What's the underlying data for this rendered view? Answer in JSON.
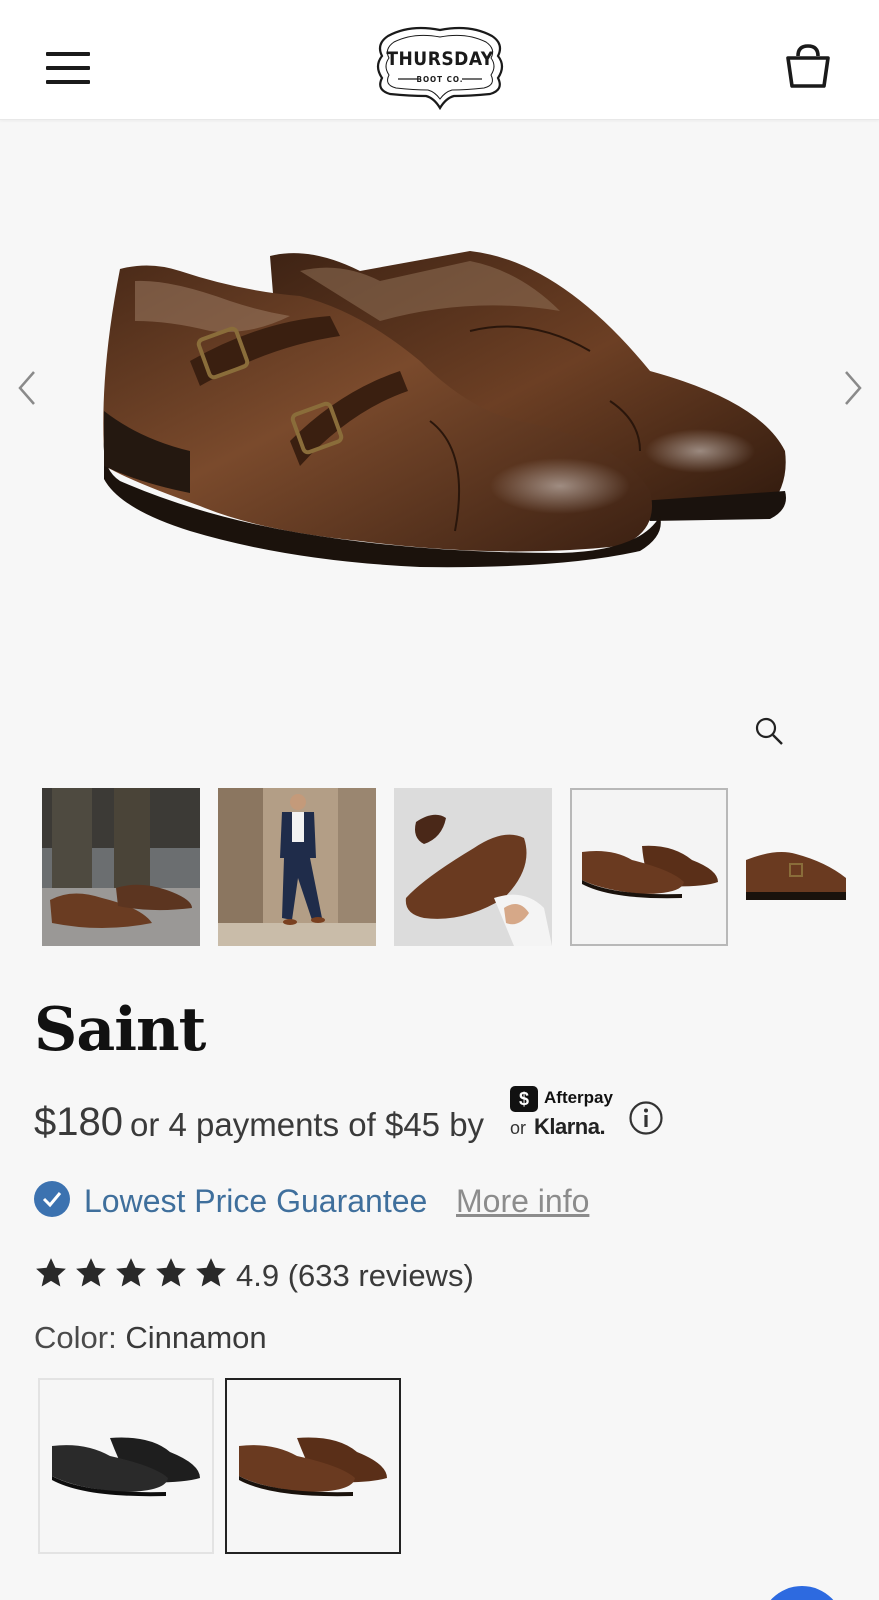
{
  "header": {
    "logo_main": "THURSDAY",
    "logo_sub": "BOOT CO.",
    "menu_icon": "hamburger-menu-icon",
    "cart_icon": "shopping-bag-icon"
  },
  "gallery": {
    "main_image": "brown double monk strap shoes",
    "thumbnails": [
      {
        "name": "on-foot-street",
        "active": false
      },
      {
        "name": "model-navy-suit",
        "active": false
      },
      {
        "name": "shoe-in-hand",
        "active": false
      },
      {
        "name": "pair-side-view",
        "active": true
      },
      {
        "name": "single-side-view",
        "active": false
      }
    ]
  },
  "product": {
    "title": "Saint",
    "price": "$180",
    "installments": "or 4 payments of $45 by",
    "afterpay_symbol": "$",
    "afterpay_label": "Afterpay",
    "or_label": "or",
    "klarna_label": "Klarna.",
    "guarantee_label": "Lowest Price Guarantee",
    "more_info_label": "More info",
    "rating_text": "4.9 (633 reviews)",
    "rating_value": 4.9,
    "color_label": "Color:",
    "color_value": "Cinnamon",
    "swatches": [
      {
        "name": "Black",
        "selected": false
      },
      {
        "name": "Cinnamon",
        "selected": true
      }
    ]
  },
  "colors": {
    "accent_blue": "#3f6f9c",
    "check_blue": "#3c72b0",
    "chat_blue": "#2d6ae0",
    "leather_brown": "#5a3320"
  }
}
